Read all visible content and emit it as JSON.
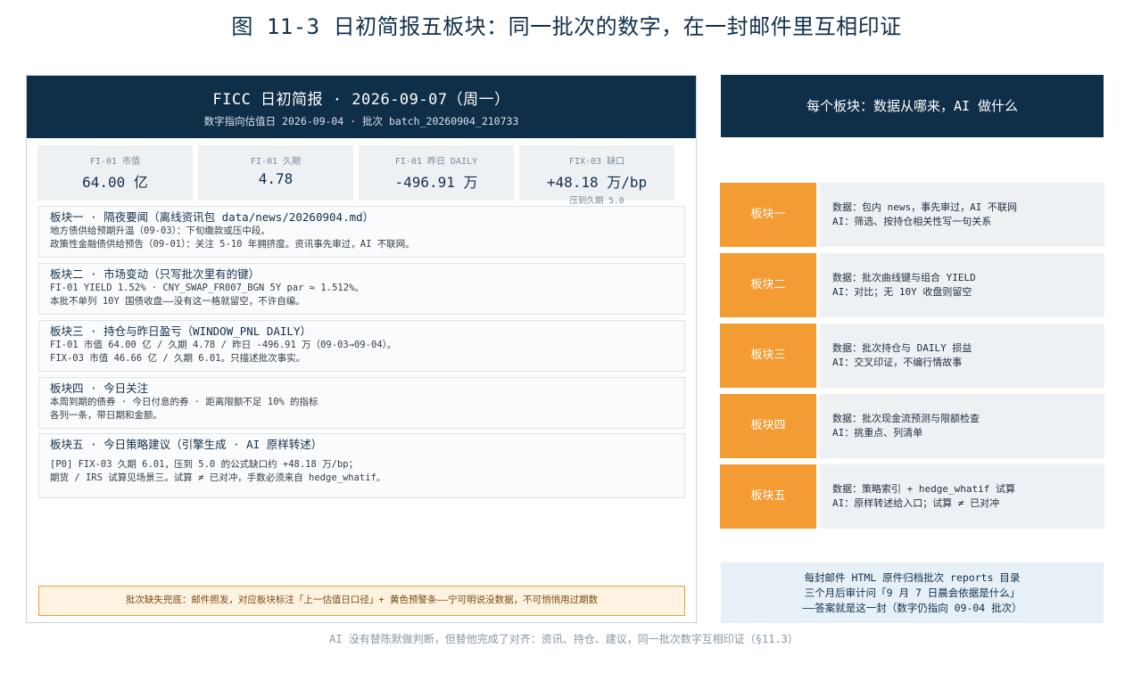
{
  "figure_title": "图 11-3 日初简报五板块：同一批次的数字，在一封邮件里互相印证",
  "email": {
    "title": "FICC 日初简报  ·  2026-09-07（周一）",
    "subtitle": "数字指向估值日 2026-09-04  ·  批次 batch_20260904_210733",
    "metrics": [
      {
        "label": "FI-01 市值",
        "value": "64.00 亿",
        "note": ""
      },
      {
        "label": "FI-01 久期",
        "value": "4.78",
        "note": ""
      },
      {
        "label": "FI-01 昨日 DAILY",
        "value": "-496.91 万",
        "note": ""
      },
      {
        "label": "FIX-03 缺口",
        "value": "+48.18 万/bp",
        "note": "压到久期 5.0"
      }
    ],
    "blocks": [
      {
        "title": "板块一  ·  隔夜要闻（离线资讯包 data/news/20260904.md）",
        "lines": [
          "地方债供给预期升温（09-03）：下旬缴款或压中段。",
          "政策性金融债供给预告（09-01）：关注 5-10 年拥挤度。资讯事先审过，AI 不联网。"
        ]
      },
      {
        "title": "板块二  ·  市场变动（只写批次里有的键）",
        "lines": [
          "FI-01 YIELD 1.52%  ·  CNY_SWAP_FR007_BGN 5Y par ≈ 1.512%。",
          "本批不单列 10Y 国债收盘——没有这一格就留空，不许自编。"
        ]
      },
      {
        "title": "板块三  ·  持仓与昨日盈亏（WINDOW_PNL DAILY）",
        "lines": [
          "FI-01 市值 64.00 亿 / 久期 4.78 / 昨日 -496.91 万（09-03→09-04）。",
          "FIX-03 市值 46.66 亿 / 久期 6.01。只描述批次事实。"
        ]
      },
      {
        "title": "板块四  ·  今日关注",
        "lines": [
          "本周到期的债券  ·  今日付息的券  ·  距离限额不足 10% 的指标",
          "各列一条，带日期和金额。"
        ]
      },
      {
        "title": "板块五  ·  今日策略建议（引擎生成  ·  AI 原样转述）",
        "lines": [
          "[P0] FIX-03 久期 6.01，压到 5.0 的公式缺口约 +48.18 万/bp；",
          "期货 / IRS 试算见场景三。试算 ≠ 已对冲，手数必须来自 hedge_whatif。"
        ]
      }
    ],
    "warning": "批次缺失兜底：邮件照发，对应板块标注「上一估值日口径」+ 黄色预警条——宁可明说没数据，不可悄悄用过期数"
  },
  "panel": {
    "title": "每个板块：数据从哪来，AI 做什么",
    "rows": [
      {
        "label": "板块一",
        "source": "数据：包内 news，事先审过，AI 不联网",
        "ai": "AI：筛选、按持仓相关性写一句关系"
      },
      {
        "label": "板块二",
        "source": "数据：批次曲线键与组合 YIELD",
        "ai": "AI：对比；无 10Y 收盘则留空"
      },
      {
        "label": "板块三",
        "source": "数据：批次持仓与 DAILY 损益",
        "ai": "AI：交叉印证，不编行情故事"
      },
      {
        "label": "板块四",
        "source": "数据：批次现金流预测与限额检查",
        "ai": "AI：挑重点、列清单"
      },
      {
        "label": "板块五",
        "source": "数据：策略索引 + hedge_whatif 试算",
        "ai": "AI：原样转述给入口；试算 ≠ 已对冲"
      }
    ],
    "note_lines": [
      "每封邮件 HTML 原件归档批次 reports 目录",
      "三个月后审计问「9 月 7 日晨会依据是什么」",
      "——答案就是这一封（数字仍指向 09-04 批次）"
    ]
  },
  "footer": "AI 没有替陈默做判断，但替他完成了对齐：资讯、持仓、建议，同一批次数字互相印证（§11.3）",
  "colors": {
    "navy": "#0f2e47",
    "orange": "#f39c33",
    "panel_gray": "#eef1f4",
    "note_blue": "#e7eff7"
  }
}
